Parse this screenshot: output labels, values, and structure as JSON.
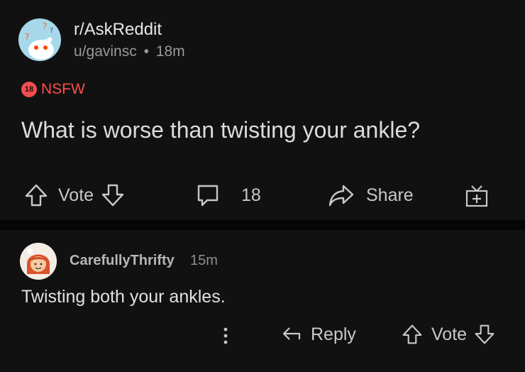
{
  "post": {
    "subreddit": "r/AskReddit",
    "author": "u/gavinsc",
    "separator": "•",
    "age": "18m",
    "nsfw_badge": "18",
    "nsfw_label": "NSFW",
    "title": "What is worse than twisting your ankle?",
    "vote_label": "Vote",
    "comment_count": "18",
    "share_label": "Share"
  },
  "comment": {
    "username": "CarefullyThrifty",
    "age": "15m",
    "body": "Twisting both your ankles.",
    "reply_label": "Reply",
    "vote_label": "Vote"
  },
  "colors": {
    "background": "#0d0d0d",
    "card": "#111111",
    "nsfw": "#ff4d4d",
    "avatar_sub": "#a6d8ea"
  },
  "icons": [
    "snoo-avatar-icon",
    "upvote-icon",
    "downvote-icon",
    "comment-icon",
    "share-icon",
    "award-icon",
    "more-vertical-icon",
    "reply-icon",
    "user-avatar-icon"
  ]
}
